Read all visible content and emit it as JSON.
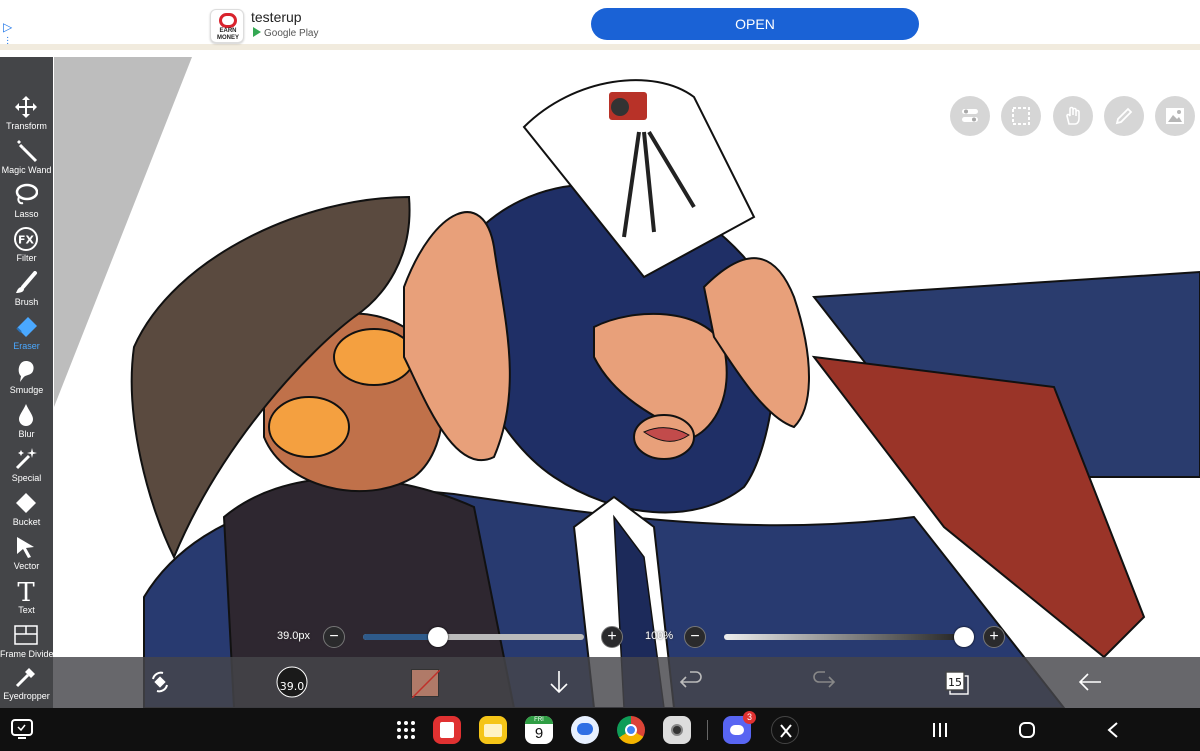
{
  "ad": {
    "app_name": "testerup",
    "icon_text": "EARN MONEY",
    "store": "Google Play",
    "cta": "OPEN"
  },
  "tools": [
    {
      "label": "Transform",
      "icon": "move-arrows-icon"
    },
    {
      "label": "Magic Wand",
      "icon": "magic-wand-icon"
    },
    {
      "label": "Lasso",
      "icon": "lasso-icon"
    },
    {
      "label": "Filter",
      "icon": "fx-filter-icon",
      "glyph": "FX"
    },
    {
      "label": "Brush",
      "icon": "brush-icon"
    },
    {
      "label": "Eraser",
      "icon": "eraser-icon",
      "active": true
    },
    {
      "label": "Smudge",
      "icon": "smudge-icon"
    },
    {
      "label": "Blur",
      "icon": "blur-drop-icon"
    },
    {
      "label": "Special",
      "icon": "special-sparkle-icon"
    },
    {
      "label": "Bucket",
      "icon": "bucket-icon"
    },
    {
      "label": "Vector",
      "icon": "vector-cursor-icon"
    },
    {
      "label": "Text",
      "icon": "text-icon",
      "glyph": "T"
    },
    {
      "label": "Frame Divider",
      "icon": "frame-divider-icon"
    },
    {
      "label": "Eyedropper",
      "icon": "eyedropper-icon"
    }
  ],
  "sliders": {
    "size": {
      "value": "39.0px",
      "fraction": 0.34,
      "color": "#2e5a8a"
    },
    "opacity": {
      "value": "100%",
      "fraction": 1.0
    }
  },
  "bottombar": {
    "brush_size_label": "39.0",
    "layers_count": "15",
    "color_swatch": "#b07a68"
  },
  "navbar": {
    "calendar_day": "FRI",
    "calendar_date": "9",
    "discord_badge": "3"
  },
  "colors": {
    "accent": "#4aa8ff",
    "panel": "#444548",
    "ad_button": "#1a62d6"
  }
}
